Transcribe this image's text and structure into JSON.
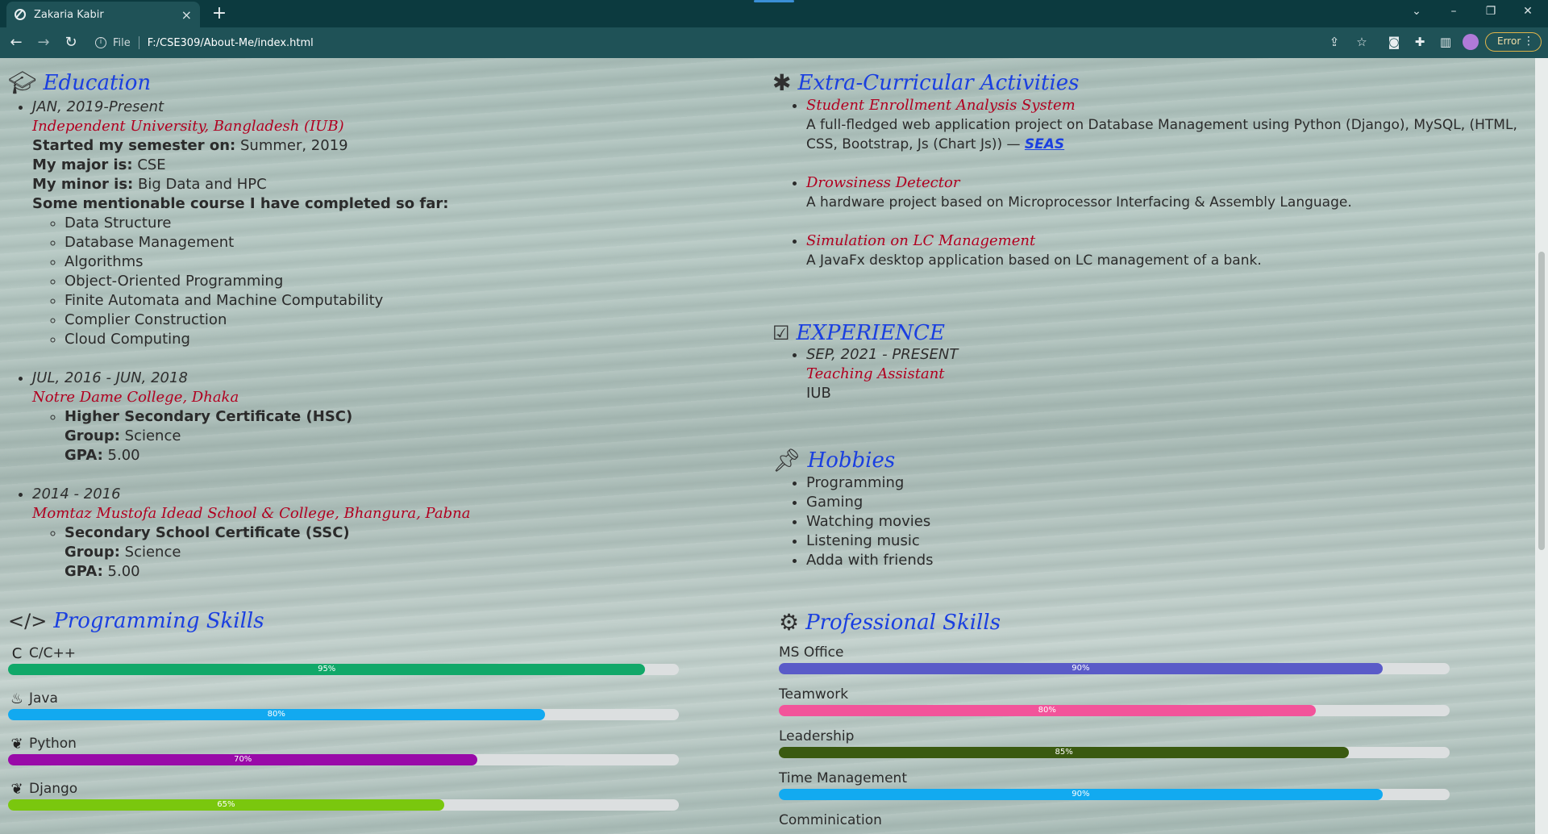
{
  "browser": {
    "tab_title": "Zakaria Kabir",
    "tab_close": "×",
    "new_tab": "+",
    "file_label": "File",
    "url": "F:/CSE309/About-Me/index.html",
    "error_label": "Error"
  },
  "education": {
    "heading": "Education",
    "entries": [
      {
        "date": "JAN, 2019-Present",
        "institution": "Independent University, Bangladesh (IUB)",
        "semester_label": "Started my semester on:",
        "semester_value": "Summer, 2019",
        "major_label": "My major is:",
        "major_value": "CSE",
        "minor_label": "My minor is:",
        "minor_value": "Big Data and HPC",
        "courses_label": "Some mentionable course I have completed so far:",
        "courses": [
          "Data Structure",
          "Database Management",
          "Algorithms",
          "Object-Oriented Programming",
          "Finite Automata and Machine Computability",
          "Complier Construction",
          "Cloud Computing"
        ]
      },
      {
        "date": "JUL, 2016 - JUN, 2018",
        "institution": "Notre Dame College, Dhaka",
        "certificate": "Higher Secondary Certificate (HSC)",
        "group_label": "Group:",
        "group_value": "Science",
        "gpa_label": "GPA:",
        "gpa_value": "5.00"
      },
      {
        "date": "2014 - 2016",
        "institution": "Momtaz Mustofa Idead School & College, Bhangura, Pabna",
        "certificate": "Secondary School Certificate (SSC)",
        "group_label": "Group:",
        "group_value": "Science",
        "gpa_label": "GPA:",
        "gpa_value": "5.00"
      }
    ]
  },
  "extracurricular": {
    "heading": "Extra-Curricular Activities",
    "items": [
      {
        "title": "Student Enrollment Analysis System",
        "desc": "A full-fledged web application project on Database Management using Python (Django), MySQL, (HTML, CSS, Bootstrap, Js (Chart Js)) —",
        "link": "SEAS"
      },
      {
        "title": "Drowsiness Detector",
        "desc": "A hardware project based on Microprocessor Interfacing & Assembly Language."
      },
      {
        "title": "Simulation on LC Management",
        "desc": "A JavaFx desktop application based on LC management of a bank."
      }
    ]
  },
  "experience": {
    "heading": "EXPERIENCE",
    "date": "SEP, 2021 - PRESENT",
    "role": "Teaching Assistant",
    "org": "IUB"
  },
  "hobbies": {
    "heading": "Hobbies",
    "items": [
      "Programming",
      "Gaming",
      "Watching movies",
      "Listening music",
      "Adda with friends"
    ]
  },
  "programming_skills": {
    "heading": "Programming Skills",
    "items": [
      {
        "name": "C/C++",
        "percent": 95,
        "label": "95%",
        "color": "#11a869",
        "icon": "c-icon"
      },
      {
        "name": "Java",
        "percent": 80,
        "label": "80%",
        "color": "#12a9f0",
        "icon": "java-icon"
      },
      {
        "name": "Python",
        "percent": 70,
        "label": "70%",
        "color": "#990aa8",
        "icon": "python-icon"
      },
      {
        "name": "Django",
        "percent": 65,
        "label": "65%",
        "color": "#7ac70e",
        "icon": "python-icon"
      }
    ]
  },
  "professional_skills": {
    "heading": "Professional Skills",
    "items": [
      {
        "name": "MS Office",
        "percent": 90,
        "label": "90%",
        "color": "#5a5bc8"
      },
      {
        "name": "Teamwork",
        "percent": 80,
        "label": "80%",
        "color": "#f2549a"
      },
      {
        "name": "Leadership",
        "percent": 85,
        "label": "85%",
        "color": "#3a5a10"
      },
      {
        "name": "Time Management",
        "percent": 90,
        "label": "90%",
        "color": "#12aaf0"
      },
      {
        "name": "Comminication"
      }
    ]
  }
}
